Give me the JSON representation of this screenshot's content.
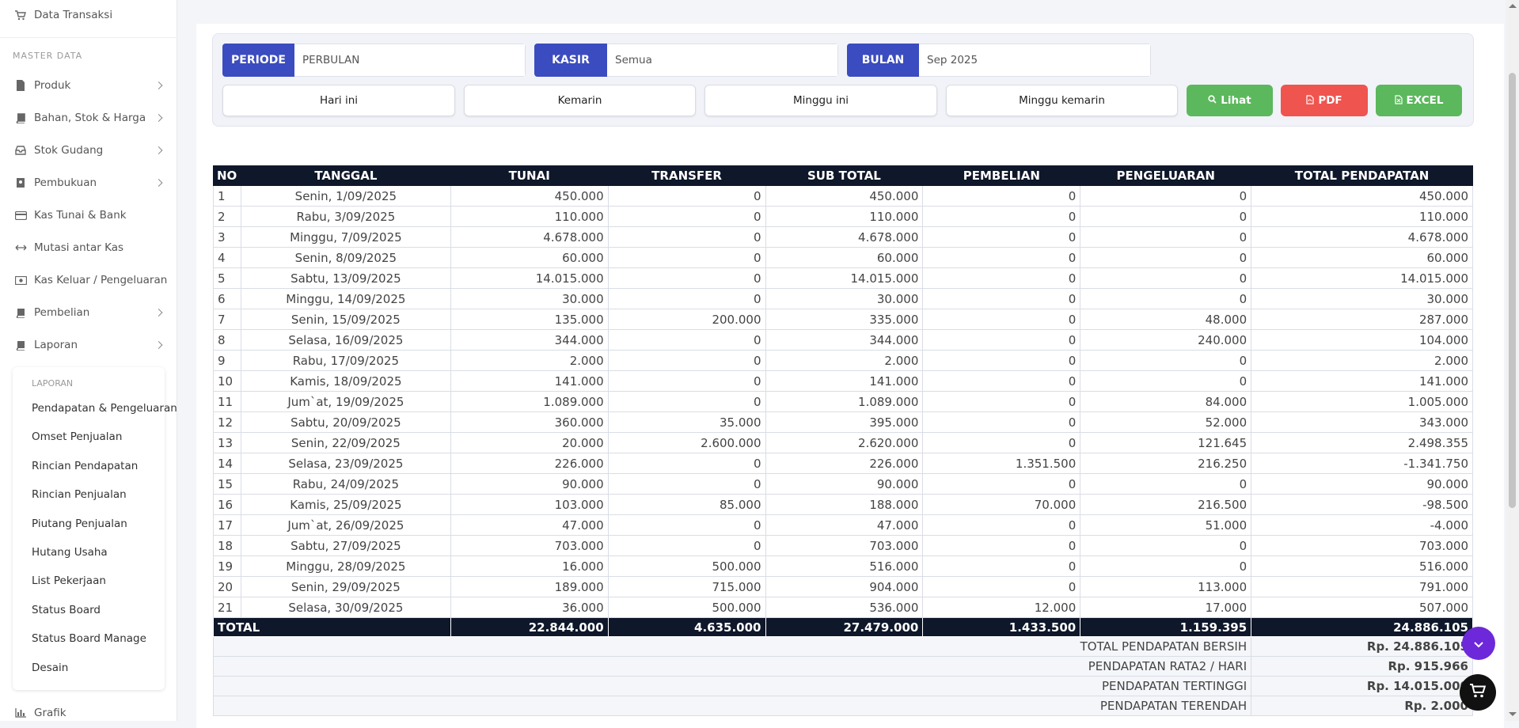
{
  "sidebar": {
    "top_item": {
      "label": "Data Transaksi",
      "icon": "cart-icon"
    },
    "section_title": "MASTER DATA",
    "items": [
      {
        "label": "Produk",
        "icon": "document-icon",
        "has_children": true
      },
      {
        "label": "Bahan, Stok & Harga",
        "icon": "book-icon",
        "has_children": true
      },
      {
        "label": "Stok Gudang",
        "icon": "inbox-icon",
        "has_children": true
      },
      {
        "label": "Pembukuan",
        "icon": "ledger-icon",
        "has_children": true
      },
      {
        "label": "Kas Tunai & Bank",
        "icon": "credit-card-icon",
        "has_children": false
      },
      {
        "label": "Mutasi antar Kas",
        "icon": "arrows-horizontal-icon",
        "has_children": false
      },
      {
        "label": "Kas Keluar / Pengeluaran",
        "icon": "money-icon",
        "has_children": false
      },
      {
        "label": "Pembelian",
        "icon": "book-icon",
        "has_children": true
      },
      {
        "label": "Laporan",
        "icon": "book-icon",
        "has_children": true
      }
    ],
    "submenu": {
      "title": "LAPORAN",
      "items": [
        "Pendapatan & Pengeluaran",
        "Omset Penjualan",
        "Rincian Pendapatan",
        "Rincian Penjualan",
        "Piutang Penjualan",
        "Hutang Usaha",
        "List Pekerjaan",
        "Status Board",
        "Status Board Manage",
        "Desain"
      ]
    },
    "bottom_item": {
      "label": "Grafik",
      "icon": "bar-chart-icon"
    }
  },
  "filters": {
    "periode": {
      "label": "PERIODE",
      "value": "PERBULAN"
    },
    "kasir": {
      "label": "KASIR",
      "value": "Semua"
    },
    "bulan": {
      "label": "BULAN",
      "value": "Sep 2025"
    }
  },
  "quick_buttons": [
    "Hari ini",
    "Kemarin",
    "Minggu ini",
    "Minggu kemarin"
  ],
  "actions": {
    "lihat": {
      "label": "Lihat",
      "color": "#5cb85c",
      "icon": "search-icon"
    },
    "pdf": {
      "label": "PDF",
      "color": "#f0544f",
      "icon": "pdf-file-icon"
    },
    "excel": {
      "label": "EXCEL",
      "color": "#5cb85c",
      "icon": "excel-file-icon"
    }
  },
  "table": {
    "headers": [
      "NO",
      "TANGGAL",
      "TUNAI",
      "TRANSFER",
      "SUB TOTAL",
      "PEMBELIAN",
      "PENGELUARAN",
      "TOTAL PENDAPATAN"
    ],
    "rows": [
      [
        "1",
        "Senin, 1/09/2025",
        "450.000",
        "0",
        "450.000",
        "0",
        "0",
        "450.000"
      ],
      [
        "2",
        "Rabu, 3/09/2025",
        "110.000",
        "0",
        "110.000",
        "0",
        "0",
        "110.000"
      ],
      [
        "3",
        "Minggu, 7/09/2025",
        "4.678.000",
        "0",
        "4.678.000",
        "0",
        "0",
        "4.678.000"
      ],
      [
        "4",
        "Senin, 8/09/2025",
        "60.000",
        "0",
        "60.000",
        "0",
        "0",
        "60.000"
      ],
      [
        "5",
        "Sabtu, 13/09/2025",
        "14.015.000",
        "0",
        "14.015.000",
        "0",
        "0",
        "14.015.000"
      ],
      [
        "6",
        "Minggu, 14/09/2025",
        "30.000",
        "0",
        "30.000",
        "0",
        "0",
        "30.000"
      ],
      [
        "7",
        "Senin, 15/09/2025",
        "135.000",
        "200.000",
        "335.000",
        "0",
        "48.000",
        "287.000"
      ],
      [
        "8",
        "Selasa, 16/09/2025",
        "344.000",
        "0",
        "344.000",
        "0",
        "240.000",
        "104.000"
      ],
      [
        "9",
        "Rabu, 17/09/2025",
        "2.000",
        "0",
        "2.000",
        "0",
        "0",
        "2.000"
      ],
      [
        "10",
        "Kamis, 18/09/2025",
        "141.000",
        "0",
        "141.000",
        "0",
        "0",
        "141.000"
      ],
      [
        "11",
        "Jum`at, 19/09/2025",
        "1.089.000",
        "0",
        "1.089.000",
        "0",
        "84.000",
        "1.005.000"
      ],
      [
        "12",
        "Sabtu, 20/09/2025",
        "360.000",
        "35.000",
        "395.000",
        "0",
        "52.000",
        "343.000"
      ],
      [
        "13",
        "Senin, 22/09/2025",
        "20.000",
        "2.600.000",
        "2.620.000",
        "0",
        "121.645",
        "2.498.355"
      ],
      [
        "14",
        "Selasa, 23/09/2025",
        "226.000",
        "0",
        "226.000",
        "1.351.500",
        "216.250",
        "-1.341.750"
      ],
      [
        "15",
        "Rabu, 24/09/2025",
        "90.000",
        "0",
        "90.000",
        "0",
        "0",
        "90.000"
      ],
      [
        "16",
        "Kamis, 25/09/2025",
        "103.000",
        "85.000",
        "188.000",
        "70.000",
        "216.500",
        "-98.500"
      ],
      [
        "17",
        "Jum`at, 26/09/2025",
        "47.000",
        "0",
        "47.000",
        "0",
        "51.000",
        "-4.000"
      ],
      [
        "18",
        "Sabtu, 27/09/2025",
        "703.000",
        "0",
        "703.000",
        "0",
        "0",
        "703.000"
      ],
      [
        "19",
        "Minggu, 28/09/2025",
        "16.000",
        "500.000",
        "516.000",
        "0",
        "0",
        "516.000"
      ],
      [
        "20",
        "Senin, 29/09/2025",
        "189.000",
        "715.000",
        "904.000",
        "0",
        "113.000",
        "791.000"
      ],
      [
        "21",
        "Selasa, 30/09/2025",
        "36.000",
        "500.000",
        "536.000",
        "12.000",
        "17.000",
        "507.000"
      ]
    ],
    "total": {
      "label": "TOTAL",
      "tunai": "22.844.000",
      "transfer": "4.635.000",
      "sub_total": "27.479.000",
      "pembelian": "1.433.500",
      "pengeluaran": "1.159.395",
      "total_pendapatan": "24.886.105"
    },
    "summary": [
      {
        "label": "TOTAL PENDAPATAN BERSIH",
        "value": "Rp. 24.886.105"
      },
      {
        "label": "PENDAPATAN RATA2 / HARI",
        "value": "Rp. 915.966"
      },
      {
        "label": "PENDAPATAN TERTINGGI",
        "value": "Rp. 14.015.000"
      },
      {
        "label": "PENDAPATAN TERENDAH",
        "value": "Rp. 2.000"
      }
    ]
  },
  "fab_scroll": {
    "icon": "chevron-down-icon",
    "color": "#6d28d9"
  },
  "fab_cart": {
    "icon": "cart-icon",
    "color": "#111111"
  }
}
